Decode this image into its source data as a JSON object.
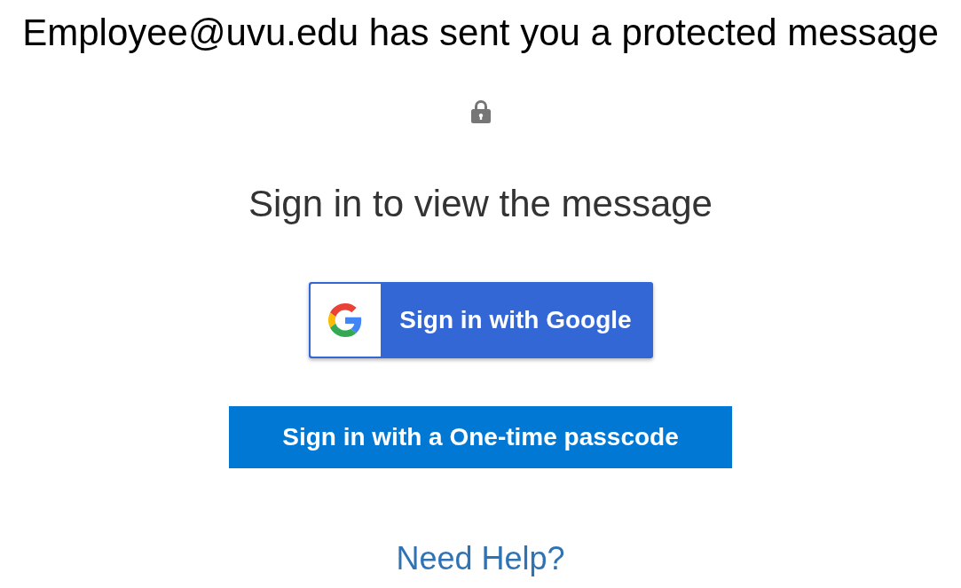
{
  "header": {
    "sender_message": "Employee@uvu.edu has sent you a protected message"
  },
  "prompt": "Sign in to view the message",
  "sign_in_options": [
    {
      "kind": "google",
      "label": "Sign in with Google"
    },
    {
      "kind": "passcode",
      "label": "Sign in with a One-time passcode"
    }
  ],
  "help_link": "Need Help?"
}
